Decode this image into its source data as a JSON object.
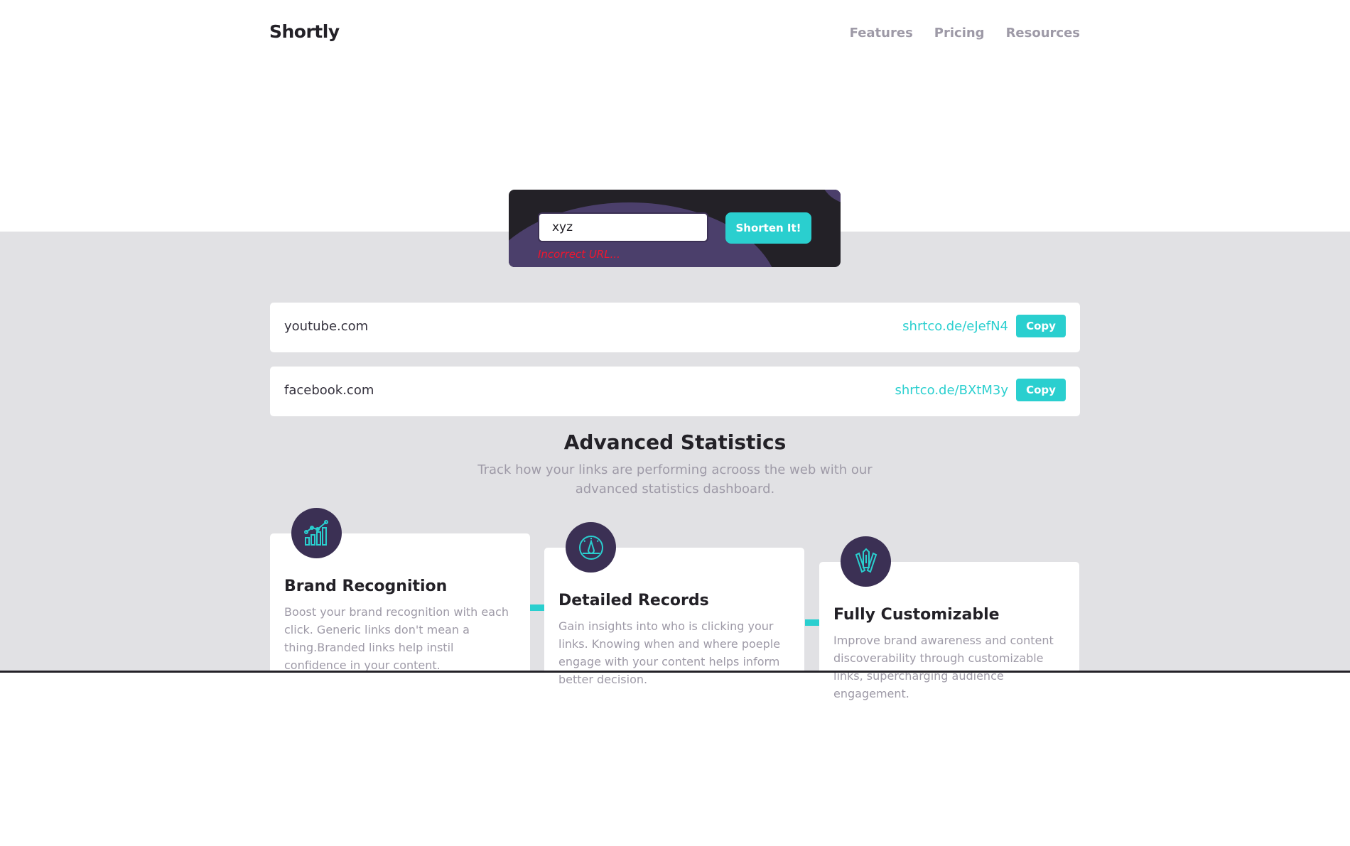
{
  "header": {
    "logo": "Shortly",
    "nav": [
      "Features",
      "Pricing",
      "Resources"
    ]
  },
  "shorten": {
    "input_value": "xyz",
    "error": "Incorrect URL...",
    "button_label": "Shorten It!"
  },
  "results": [
    {
      "original": "youtube.com",
      "short": "shrtco.de/eJefN4",
      "copy_label": "Copy"
    },
    {
      "original": "facebook.com",
      "short": "shrtco.de/BXtM3y",
      "copy_label": "Copy"
    }
  ],
  "stats": {
    "title": "Advanced Statistics",
    "subtitle": "Track how your links are performing acrooss the web with our advanced statistics dashboard.",
    "cards": [
      {
        "icon": "brand-recognition-icon",
        "title": "Brand Recognition",
        "text": "Boost your brand recognition with each click. Generic links don't mean a thing.Branded links help instil confidence in your content."
      },
      {
        "icon": "detailed-records-icon",
        "title": "Detailed Records",
        "text": "Gain insights into who is clicking your links. Knowing when and where poeple engage with your content helps inform better decision."
      },
      {
        "icon": "fully-customizable-icon",
        "title": "Fully Customizable",
        "text": "Improve brand awareness and content discoverability through customizable links, supercharging audience engagement."
      }
    ]
  },
  "colors": {
    "accent": "#2acfcf",
    "dark": "#232127",
    "violet": "#3b3054",
    "error": "#f0152e",
    "gray_bg": "#e1e1e4"
  }
}
